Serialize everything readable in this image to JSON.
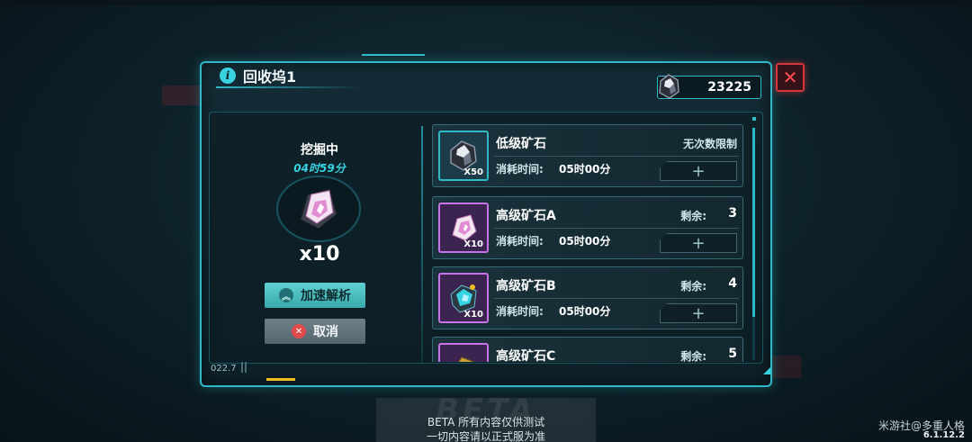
{
  "window": {
    "title": "回收坞1",
    "currency_value": "23225",
    "close_icon": "close-x"
  },
  "left": {
    "status": "挖掘中",
    "time_remaining": "04时59分",
    "ore_quantity": "x10",
    "accelerate_label": "加速解析",
    "cancel_label": "取消",
    "coord_readout": "022.7"
  },
  "list": {
    "items": [
      {
        "name": "低级矿石",
        "thumb_qty": "X50",
        "limit_text": "无次数限制",
        "cost_label": "消耗时间:",
        "cost_value": "05时00分",
        "plus": "+"
      },
      {
        "name": "高级矿石A",
        "thumb_qty": "X10",
        "remain_label": "剩余:",
        "remain_value": "3",
        "cost_label": "消耗时间:",
        "cost_value": "05时00分",
        "plus": "+"
      },
      {
        "name": "高级矿石B",
        "thumb_qty": "X10",
        "remain_label": "剩余:",
        "remain_value": "4",
        "cost_label": "消耗时间:",
        "cost_value": "05时00分",
        "plus": "+"
      },
      {
        "name": "高级矿石C",
        "remain_label": "剩余:",
        "remain_value": "5"
      }
    ]
  },
  "beta": {
    "big": "BETA",
    "line1": "BETA  所有内容仅供测试",
    "line2": "一切内容请以正式服为准"
  },
  "footer": {
    "watermark": "米游社@多重人格",
    "version": "6.1.12.2"
  },
  "colors": {
    "accent": "#2fb9c9",
    "close": "#d6353e",
    "highlight_time": "#39d2e0",
    "rare_border": "#c874e8"
  }
}
